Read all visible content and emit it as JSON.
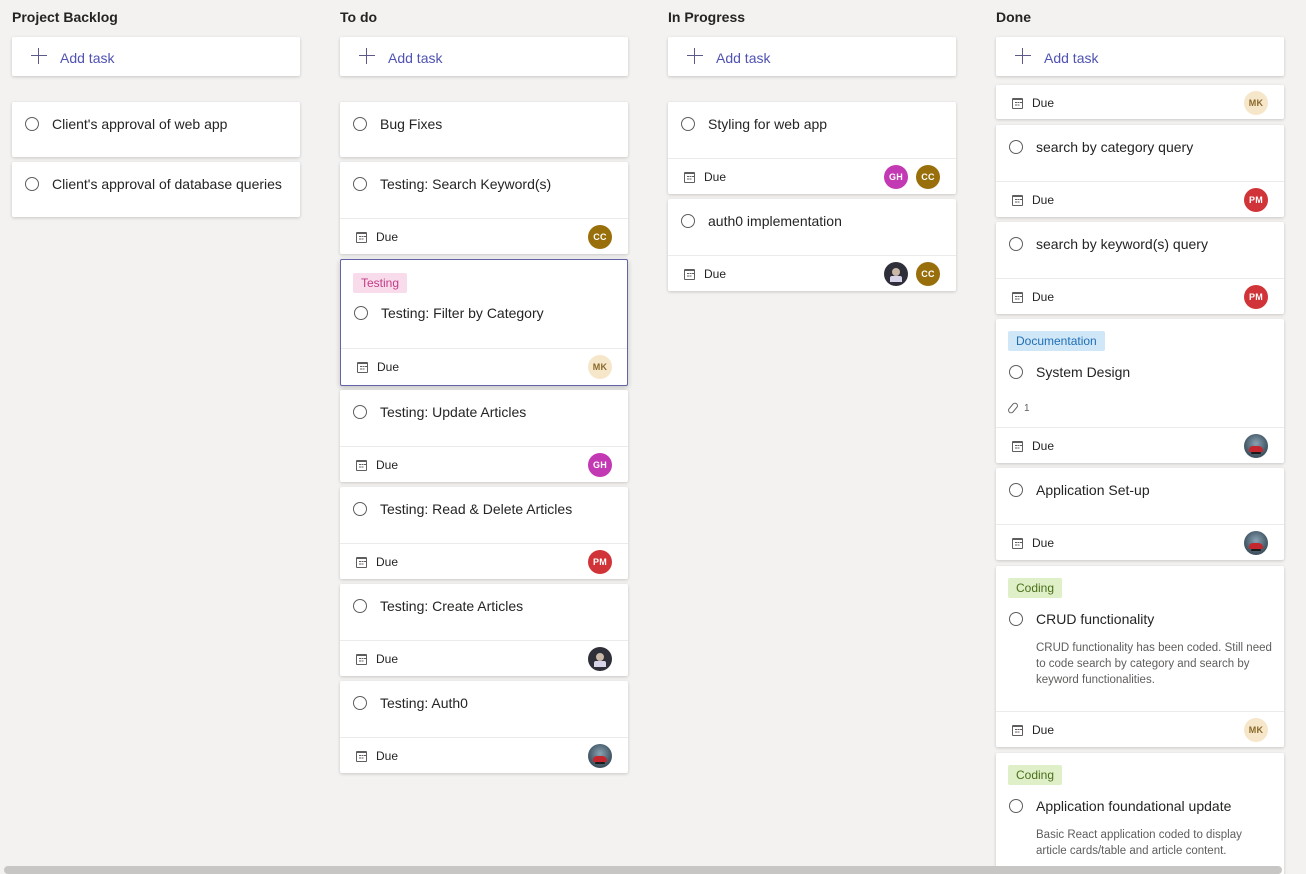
{
  "add_task_label": "Add task",
  "due_label": "Due",
  "columns": [
    {
      "title": "Project Backlog",
      "cards": [
        {
          "title": "Client's approval of web app"
        },
        {
          "title": "Client's approval of database queries"
        }
      ]
    },
    {
      "title": "To do",
      "cards": [
        {
          "title": "Bug Fixes"
        },
        {
          "title": "Testing: Search Keyword(s)",
          "assignees": [
            "CC"
          ]
        },
        {
          "tag": "Testing",
          "title": "Testing: Filter by Category",
          "assignees": [
            "MK"
          ]
        },
        {
          "title": "Testing: Update Articles",
          "assignees": [
            "GH"
          ]
        },
        {
          "title": "Testing: Read & Delete Articles",
          "assignees": [
            "PM"
          ]
        },
        {
          "title": "Testing: Create Articles",
          "assignees": [
            "avatar-photo-dark"
          ]
        },
        {
          "title": "Testing: Auth0",
          "assignees": [
            "avatar-photo-car"
          ]
        }
      ]
    },
    {
      "title": "In Progress",
      "cards": [
        {
          "title": "Styling for web app",
          "assignees": [
            "GH",
            "CC"
          ]
        },
        {
          "title": "auth0 implementation",
          "assignees": [
            "avatar-photo-dark",
            "CC"
          ]
        }
      ]
    },
    {
      "title": "Done",
      "cards": [
        {
          "assignees": [
            "MK"
          ]
        },
        {
          "title": "search by category query",
          "assignees": [
            "PM"
          ]
        },
        {
          "title": "search by keyword(s) query",
          "assignees": [
            "PM"
          ]
        },
        {
          "tag": "Documentation",
          "title": "System Design",
          "attachments": "1",
          "assignees": [
            "avatar-photo-car"
          ]
        },
        {
          "title": "Application Set-up",
          "assignees": [
            "avatar-photo-car"
          ]
        },
        {
          "tag": "Coding",
          "title": "CRUD functionality",
          "description": "CRUD functionality has been coded. Still need to code search by category and search by keyword functionalities.",
          "assignees": [
            "MK"
          ]
        },
        {
          "tag": "Coding",
          "title": "Application foundational update",
          "description": "Basic React application coded to display article cards/table and article content."
        }
      ]
    }
  ],
  "colors": {
    "background": "#f3f2f1",
    "accent": "#6264a7",
    "avatar_cc": "#986f0b",
    "avatar_gh": "#c239b3",
    "avatar_pm": "#d13438",
    "avatar_mk": "#f6e6ca",
    "tag_testing": "#f9dceb",
    "tag_documentation": "#d0e7f8",
    "tag_coding": "#dff0c8"
  }
}
